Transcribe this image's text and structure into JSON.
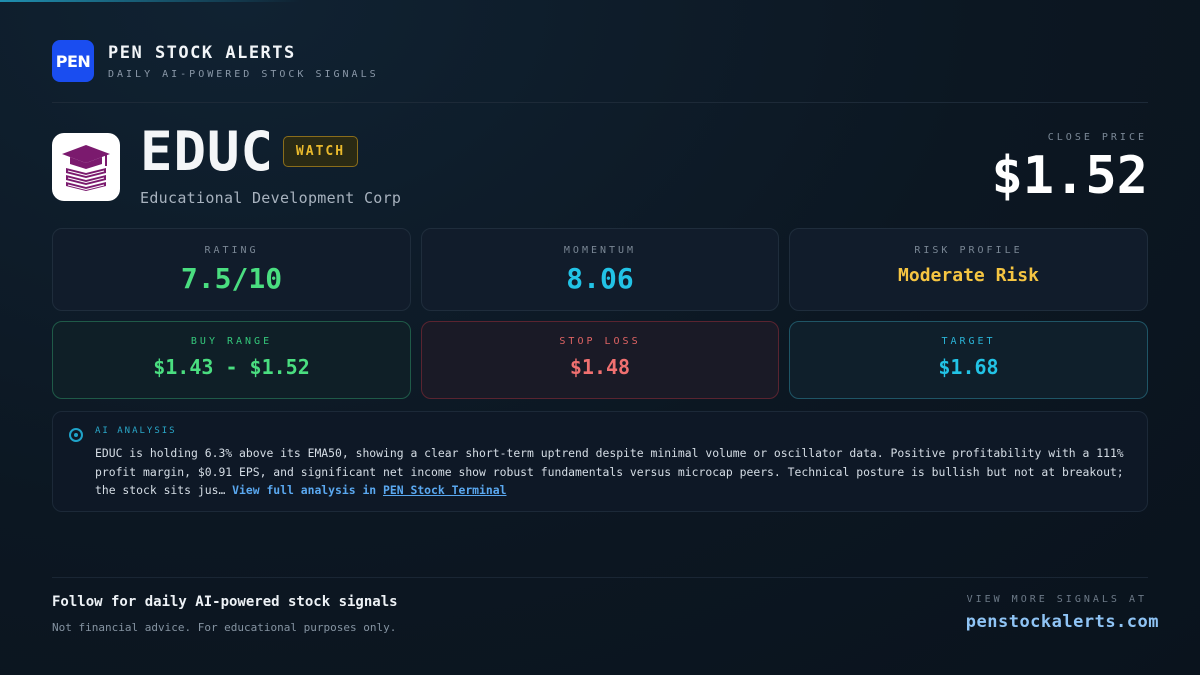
{
  "brand": {
    "logo_text": "PEN",
    "name": "PEN STOCK ALERTS",
    "tagline": "DAILY AI-POWERED STOCK SIGNALS"
  },
  "stock": {
    "ticker": "EDUC",
    "badge": "WATCH",
    "company": "Educational Development Corp",
    "close_label": "CLOSE PRICE",
    "close_price": "$1.52",
    "logo_icon": "graduation-cap-books-icon"
  },
  "metrics": {
    "rating": {
      "label": "RATING",
      "value": "7.5/10",
      "color": "#4ade80"
    },
    "momentum": {
      "label": "MOMENTUM",
      "value": "8.06",
      "color": "#22c3e6"
    },
    "risk": {
      "label": "RISK PROFILE",
      "value": "Moderate Risk",
      "color": "#f5c542"
    },
    "buy_range": {
      "label": "BUY RANGE",
      "value": "$1.43 - $1.52",
      "color": "#4ade80",
      "label_color": "#34c77b"
    },
    "stop_loss": {
      "label": "STOP LOSS",
      "value": "$1.48",
      "color": "#f07070",
      "label_color": "#e06464"
    },
    "target": {
      "label": "TARGET",
      "value": "$1.68",
      "color": "#22c3e6",
      "label_color": "#2ab3d6"
    }
  },
  "analysis": {
    "label": "AI ANALYSIS",
    "text": "EDUC is holding 6.3% above its EMA50, showing a clear short-term uptrend despite minimal volume or oscillator data. Positive profitability with a 111% profit margin, $0.91 EPS, and significant net income show robust fundamentals versus microcap peers. Technical posture is bullish but not at breakout; the stock sits jus… ",
    "link_prefix": "View full analysis in ",
    "link_text": "PEN Stock Terminal"
  },
  "footer": {
    "follow": "Follow for daily AI-powered stock signals",
    "disclaimer": "Not financial advice. For educational purposes only.",
    "more_label": "VIEW MORE SIGNALS AT",
    "url": "penstockalerts.com"
  }
}
